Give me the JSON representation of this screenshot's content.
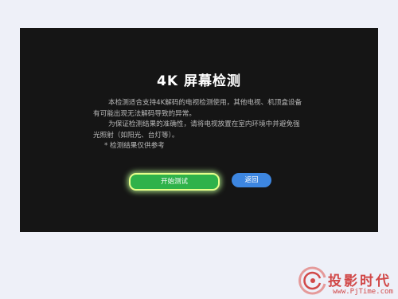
{
  "screen": {
    "title": "4K 屏幕检测",
    "description": {
      "paragraph1_line1": "本检测适合支持4K解码的电视检测使用，其他电视、机顶盒设备",
      "paragraph1_line2": "有可能出现无法解码导致的异常。",
      "paragraph2_line1": "为保证检测结果的准确性，请将电视放置在室内环境中并避免强",
      "paragraph2_line2": "光照射（如阳光、台灯等）。",
      "note": "* 检测结果仅供参考"
    },
    "buttons": {
      "start_label": "开始测试",
      "back_label": "返回"
    }
  },
  "watermark": {
    "brand": "投影时代",
    "site": "www.PjTime.com"
  },
  "colors": {
    "screen_background": "#151515",
    "start_button": "#2fb24a",
    "start_button_glow": "#e6ff8a",
    "back_button": "#3d86e0",
    "watermark": "#d14848"
  }
}
